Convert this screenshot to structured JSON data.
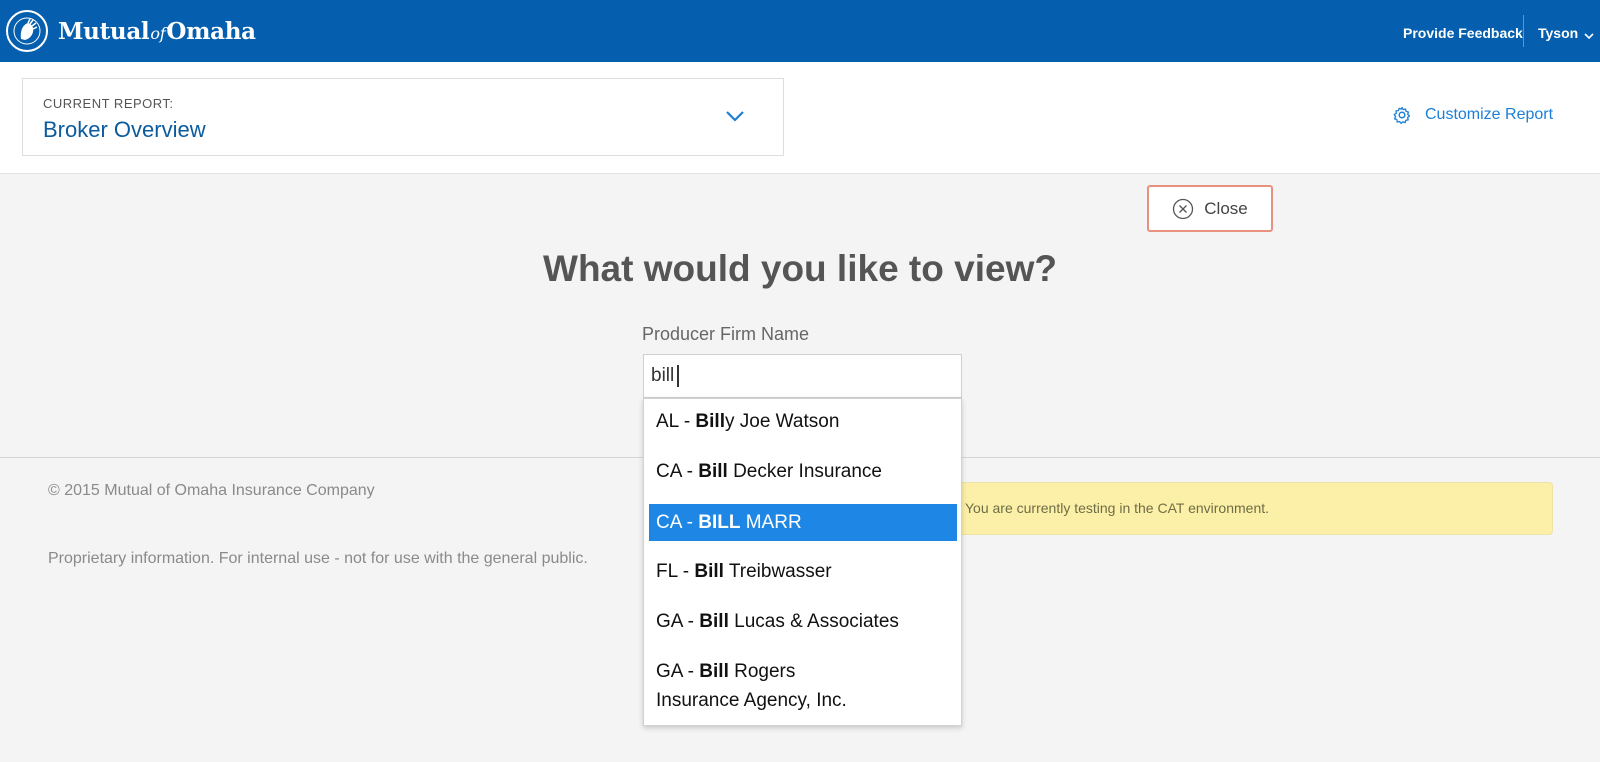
{
  "header": {
    "logo": {
      "name_first": "Mutual",
      "name_of": "of",
      "name_last": "Omaha"
    },
    "feedback_label": "Provide Feedback",
    "user_name": "Tyson"
  },
  "report": {
    "label": "CURRENT REPORT:",
    "name": "Broker Overview",
    "customize_label": "Customize Report"
  },
  "panel": {
    "close_label": "Close",
    "question": "What would you like to view?",
    "field_label": "Producer Firm Name",
    "input_value": "bill"
  },
  "autocomplete": [
    {
      "prefix": "AL - ",
      "match": "Bill",
      "rest": "y Joe Watson",
      "selected": false
    },
    {
      "prefix": "CA - ",
      "match": "Bill",
      "rest": " Decker Insurance",
      "selected": false
    },
    {
      "prefix": "CA - ",
      "match": "BILL",
      "rest": " MARR",
      "selected": true
    },
    {
      "prefix": "FL - ",
      "match": "Bill",
      "rest": " Treibwasser",
      "selected": false
    },
    {
      "prefix": "GA - ",
      "match": "Bill",
      "rest": " Lucas & Associates",
      "selected": false
    },
    {
      "prefix": "GA - ",
      "match": "Bill",
      "rest": " Rogers Insurance Agency, Inc.",
      "selected": false
    }
  ],
  "footer": {
    "copyright": "© 2015 Mutual of Omaha Insurance Company",
    "proprietary": "Proprietary information. For internal use - not for use with the general public.",
    "environment_notice": "You are currently testing in the CAT environment."
  },
  "colors": {
    "header_blue": "#055fae",
    "link_blue": "#1c7fd7",
    "selected_blue": "#1e87e5",
    "notice_yellow": "#fcefa7",
    "close_border": "#e8917f"
  }
}
